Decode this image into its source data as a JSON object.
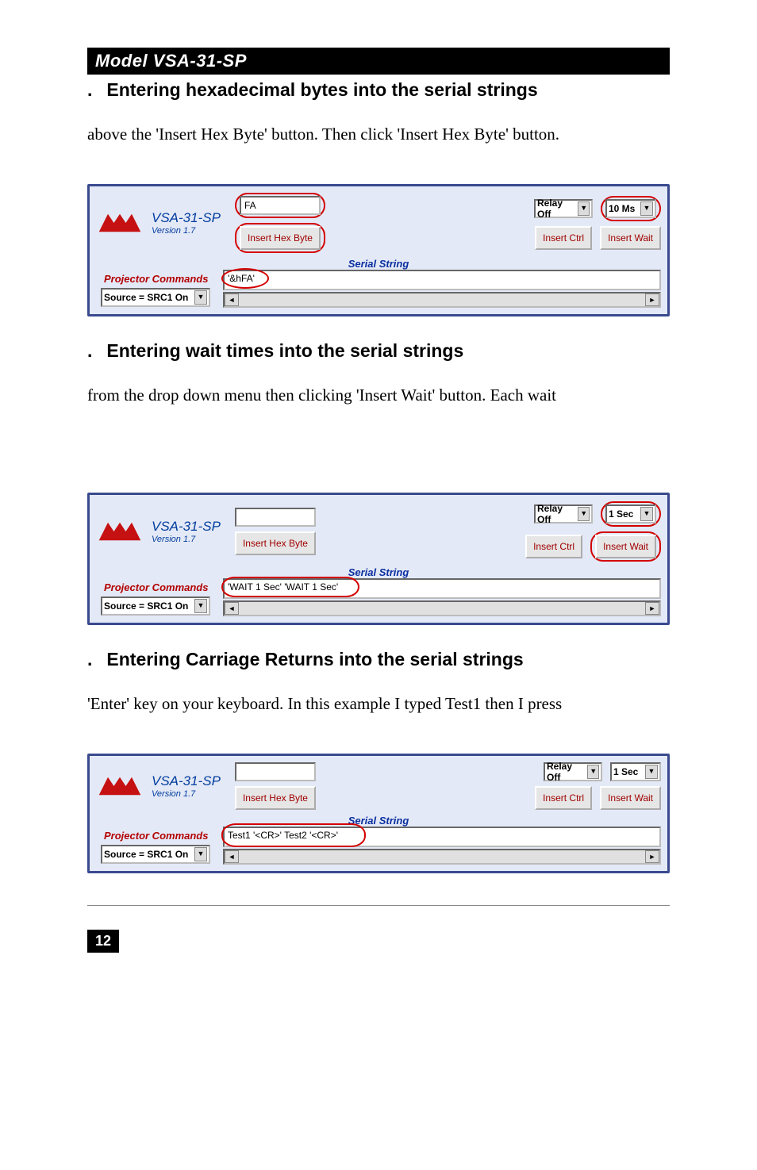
{
  "header": {
    "model": "Model VSA-31-SP"
  },
  "section1": {
    "heading": "Entering hexadecimal bytes into the serial strings",
    "body": "above the 'Insert Hex Byte' button. Then click 'Insert Hex Byte' button."
  },
  "section2": {
    "heading": "Entering wait times into the serial strings",
    "body": "from the drop down menu then clicking 'Insert Wait' button. Each wait"
  },
  "section3": {
    "heading": "Entering Carriage Returns into the serial strings",
    "body": "'Enter' key on your keyboard. In this example I typed Test1 then I press"
  },
  "app": {
    "name": "VSA-31-SP",
    "version": "Version 1.7",
    "insert_hex_label": "Insert Hex Byte",
    "insert_ctrl_label": "Insert Ctrl",
    "insert_wait_label": "Insert Wait",
    "serial_string_label": "Serial String",
    "proj_cmds_label": "Projector Commands",
    "source_select": "Source = SRC1 On",
    "relay_select": "Relay Off"
  },
  "fig1": {
    "hex_input": "FA",
    "wait_select": "10 Ms",
    "serial_value": "'&hFA' "
  },
  "fig2": {
    "hex_input": "",
    "wait_select": "1 Sec",
    "serial_value": "'WAIT  1 Sec'  'WAIT  1 Sec' "
  },
  "fig3": {
    "hex_input": "",
    "wait_select": "1 Sec",
    "serial_value": "Test1 '<CR>' Test2 '<CR>' "
  },
  "page_number": "12"
}
